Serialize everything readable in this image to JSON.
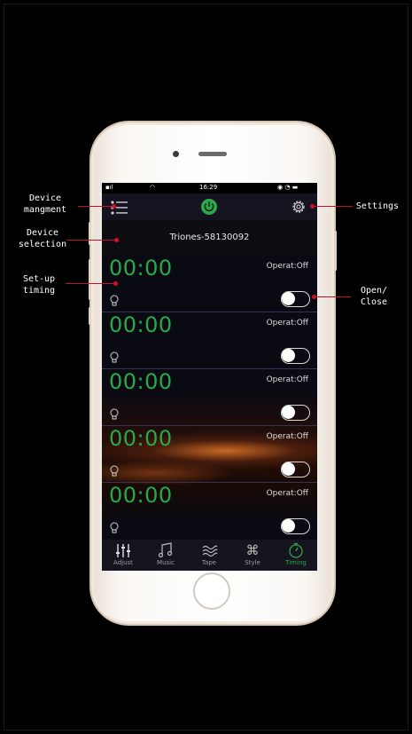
{
  "statusbar": {
    "time": "16:29"
  },
  "header": {
    "device_name": "Triones-58130092"
  },
  "timers": [
    {
      "time": "00:00",
      "status": "Operat:Off"
    },
    {
      "time": "00:00",
      "status": "Operat:Off"
    },
    {
      "time": "00:00",
      "status": "Operat:Off"
    },
    {
      "time": "00:00",
      "status": "Operat:Off"
    },
    {
      "time": "00:00",
      "status": "Operat:Off"
    }
  ],
  "tabs": [
    {
      "label": "Adjust",
      "icon": "sliders-icon"
    },
    {
      "label": "Music",
      "icon": "music-note-icon"
    },
    {
      "label": "Tape",
      "icon": "waves-icon"
    },
    {
      "label": "Style",
      "icon": "command-icon"
    },
    {
      "label": "Timing",
      "icon": "timer-icon",
      "active": true
    }
  ],
  "annotations": {
    "device_management": "Device\nmangment",
    "device_selection": "Device\nselection",
    "setup_timing": "Set-up\ntiming",
    "settings": "Settings",
    "open_close": "Open/\nClose"
  },
  "colors": {
    "accent_green": "#2aa84a",
    "annotation_red": "#c0102a",
    "background": "#000000"
  }
}
